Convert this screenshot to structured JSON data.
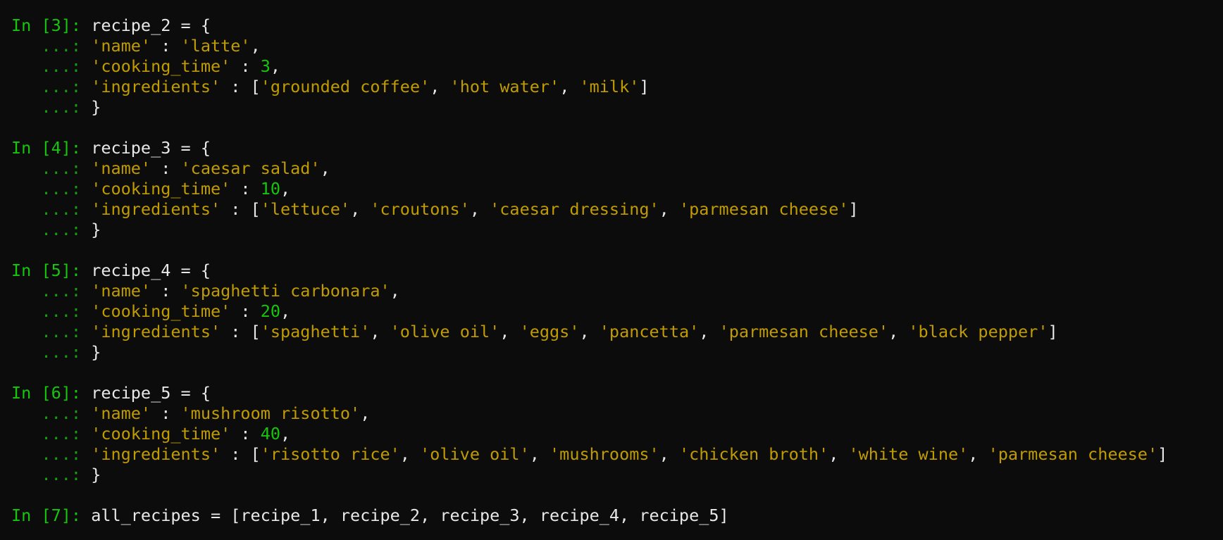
{
  "terminal": {
    "lines": [
      {
        "kind": "code",
        "segments": [
          {
            "t": "prompt",
            "v": "In [3]: "
          },
          {
            "t": "txt",
            "v": "recipe_2 = {"
          }
        ]
      },
      {
        "kind": "code",
        "segments": [
          {
            "t": "cont",
            "v": "   ...: "
          },
          {
            "t": "str",
            "v": "'name'"
          },
          {
            "t": "txt",
            "v": " : "
          },
          {
            "t": "str",
            "v": "'latte'"
          },
          {
            "t": "txt",
            "v": ","
          }
        ]
      },
      {
        "kind": "code",
        "segments": [
          {
            "t": "cont",
            "v": "   ...: "
          },
          {
            "t": "str",
            "v": "'cooking_time'"
          },
          {
            "t": "txt",
            "v": " : "
          },
          {
            "t": "num",
            "v": "3"
          },
          {
            "t": "txt",
            "v": ","
          }
        ]
      },
      {
        "kind": "code",
        "segments": [
          {
            "t": "cont",
            "v": "   ...: "
          },
          {
            "t": "str",
            "v": "'ingredients'"
          },
          {
            "t": "txt",
            "v": " : ["
          },
          {
            "t": "str",
            "v": "'grounded coffee'"
          },
          {
            "t": "txt",
            "v": ", "
          },
          {
            "t": "str",
            "v": "'hot water'"
          },
          {
            "t": "txt",
            "v": ", "
          },
          {
            "t": "str",
            "v": "'milk'"
          },
          {
            "t": "txt",
            "v": "]"
          }
        ]
      },
      {
        "kind": "code",
        "segments": [
          {
            "t": "cont",
            "v": "   ...: "
          },
          {
            "t": "txt",
            "v": "}"
          }
        ]
      },
      {
        "kind": "blank",
        "segments": []
      },
      {
        "kind": "code",
        "segments": [
          {
            "t": "prompt",
            "v": "In [4]: "
          },
          {
            "t": "txt",
            "v": "recipe_3 = {"
          }
        ]
      },
      {
        "kind": "code",
        "segments": [
          {
            "t": "cont",
            "v": "   ...: "
          },
          {
            "t": "str",
            "v": "'name'"
          },
          {
            "t": "txt",
            "v": " : "
          },
          {
            "t": "str",
            "v": "'caesar salad'"
          },
          {
            "t": "txt",
            "v": ","
          }
        ]
      },
      {
        "kind": "code",
        "segments": [
          {
            "t": "cont",
            "v": "   ...: "
          },
          {
            "t": "str",
            "v": "'cooking_time'"
          },
          {
            "t": "txt",
            "v": " : "
          },
          {
            "t": "num",
            "v": "10"
          },
          {
            "t": "txt",
            "v": ","
          }
        ]
      },
      {
        "kind": "code",
        "segments": [
          {
            "t": "cont",
            "v": "   ...: "
          },
          {
            "t": "str",
            "v": "'ingredients'"
          },
          {
            "t": "txt",
            "v": " : ["
          },
          {
            "t": "str",
            "v": "'lettuce'"
          },
          {
            "t": "txt",
            "v": ", "
          },
          {
            "t": "str",
            "v": "'croutons'"
          },
          {
            "t": "txt",
            "v": ", "
          },
          {
            "t": "str",
            "v": "'caesar dressing'"
          },
          {
            "t": "txt",
            "v": ", "
          },
          {
            "t": "str",
            "v": "'parmesan cheese'"
          },
          {
            "t": "txt",
            "v": "]"
          }
        ]
      },
      {
        "kind": "code",
        "segments": [
          {
            "t": "cont",
            "v": "   ...: "
          },
          {
            "t": "txt",
            "v": "}"
          }
        ]
      },
      {
        "kind": "blank",
        "segments": []
      },
      {
        "kind": "code",
        "segments": [
          {
            "t": "prompt",
            "v": "In [5]: "
          },
          {
            "t": "txt",
            "v": "recipe_4 = {"
          }
        ]
      },
      {
        "kind": "code",
        "segments": [
          {
            "t": "cont",
            "v": "   ...: "
          },
          {
            "t": "str",
            "v": "'name'"
          },
          {
            "t": "txt",
            "v": " : "
          },
          {
            "t": "str",
            "v": "'spaghetti carbonara'"
          },
          {
            "t": "txt",
            "v": ","
          }
        ]
      },
      {
        "kind": "code",
        "segments": [
          {
            "t": "cont",
            "v": "   ...: "
          },
          {
            "t": "str",
            "v": "'cooking_time'"
          },
          {
            "t": "txt",
            "v": " : "
          },
          {
            "t": "num",
            "v": "20"
          },
          {
            "t": "txt",
            "v": ","
          }
        ]
      },
      {
        "kind": "code",
        "segments": [
          {
            "t": "cont",
            "v": "   ...: "
          },
          {
            "t": "str",
            "v": "'ingredients'"
          },
          {
            "t": "txt",
            "v": " : ["
          },
          {
            "t": "str",
            "v": "'spaghetti'"
          },
          {
            "t": "txt",
            "v": ", "
          },
          {
            "t": "str",
            "v": "'olive oil'"
          },
          {
            "t": "txt",
            "v": ", "
          },
          {
            "t": "str",
            "v": "'eggs'"
          },
          {
            "t": "txt",
            "v": ", "
          },
          {
            "t": "str",
            "v": "'pancetta'"
          },
          {
            "t": "txt",
            "v": ", "
          },
          {
            "t": "str",
            "v": "'parmesan cheese'"
          },
          {
            "t": "txt",
            "v": ", "
          },
          {
            "t": "str",
            "v": "'black pepper'"
          },
          {
            "t": "txt",
            "v": "]"
          }
        ]
      },
      {
        "kind": "code",
        "segments": [
          {
            "t": "cont",
            "v": "   ...: "
          },
          {
            "t": "txt",
            "v": "}"
          }
        ]
      },
      {
        "kind": "blank",
        "segments": []
      },
      {
        "kind": "code",
        "segments": [
          {
            "t": "prompt",
            "v": "In [6]: "
          },
          {
            "t": "txt",
            "v": "recipe_5 = {"
          }
        ]
      },
      {
        "kind": "code",
        "segments": [
          {
            "t": "cont",
            "v": "   ...: "
          },
          {
            "t": "str",
            "v": "'name'"
          },
          {
            "t": "txt",
            "v": " : "
          },
          {
            "t": "str",
            "v": "'mushroom risotto'"
          },
          {
            "t": "txt",
            "v": ","
          }
        ]
      },
      {
        "kind": "code",
        "segments": [
          {
            "t": "cont",
            "v": "   ...: "
          },
          {
            "t": "str",
            "v": "'cooking_time'"
          },
          {
            "t": "txt",
            "v": " : "
          },
          {
            "t": "num",
            "v": "40"
          },
          {
            "t": "txt",
            "v": ","
          }
        ]
      },
      {
        "kind": "code",
        "segments": [
          {
            "t": "cont",
            "v": "   ...: "
          },
          {
            "t": "str",
            "v": "'ingredients'"
          },
          {
            "t": "txt",
            "v": " : ["
          },
          {
            "t": "str",
            "v": "'risotto rice'"
          },
          {
            "t": "txt",
            "v": ", "
          },
          {
            "t": "str",
            "v": "'olive oil'"
          },
          {
            "t": "txt",
            "v": ", "
          },
          {
            "t": "str",
            "v": "'mushrooms'"
          },
          {
            "t": "txt",
            "v": ", "
          },
          {
            "t": "str",
            "v": "'chicken broth'"
          },
          {
            "t": "txt",
            "v": ", "
          },
          {
            "t": "str",
            "v": "'white wine'"
          },
          {
            "t": "txt",
            "v": ", "
          },
          {
            "t": "str",
            "v": "'parmesan cheese'"
          },
          {
            "t": "txt",
            "v": "]"
          }
        ]
      },
      {
        "kind": "code",
        "segments": [
          {
            "t": "cont",
            "v": "   ...: "
          },
          {
            "t": "txt",
            "v": "}"
          }
        ]
      },
      {
        "kind": "blank",
        "segments": []
      },
      {
        "kind": "code",
        "segments": [
          {
            "t": "prompt",
            "v": "In [7]: "
          },
          {
            "t": "txt",
            "v": "all_recipes = [recipe_1, recipe_2, recipe_3, recipe_4, recipe_5]"
          }
        ]
      }
    ]
  },
  "colors": {
    "background": "#0c0c0c",
    "prompt": "#16c60c",
    "continuation": "#13a10e",
    "string": "#c19c00",
    "number": "#16c60c",
    "text": "#e8e8e8"
  }
}
